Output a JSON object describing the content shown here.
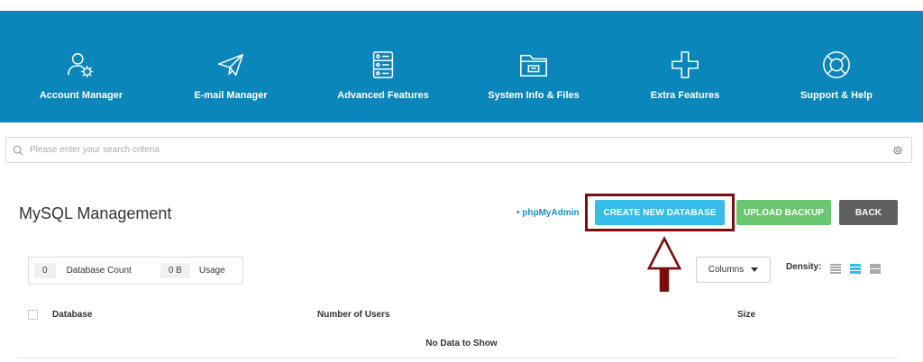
{
  "nav": {
    "items": [
      {
        "label": "Account Manager",
        "icon": "users-icon"
      },
      {
        "label": "E-mail Manager",
        "icon": "paper-plane-icon"
      },
      {
        "label": "Advanced Features",
        "icon": "server-icon"
      },
      {
        "label": "System Info & Files",
        "icon": "folder-icon"
      },
      {
        "label": "Extra Features",
        "icon": "plus-icon"
      },
      {
        "label": "Support & Help",
        "icon": "lifebuoy-icon"
      }
    ],
    "background": "#0a86bb"
  },
  "search": {
    "placeholder": "Please enter your search criteria"
  },
  "page": {
    "title": "MySQL Management",
    "phpmyadmin_link": "• phpMyAdmin"
  },
  "actions": {
    "create_label": "CREATE NEW DATABASE",
    "upload_label": "UPLOAD BACKUP",
    "back_label": "BACK",
    "colors": {
      "create": "#33bde8",
      "upload": "#6cc56f",
      "back": "#5f6062",
      "highlight": "#7a0d0d"
    }
  },
  "stats": {
    "db_count_value": "0",
    "db_count_label": "Database Count",
    "usage_value": "0 B",
    "usage_label": "Usage"
  },
  "controls": {
    "columns_label": "Columns",
    "density_label": "Density:"
  },
  "table": {
    "headers": [
      "Database",
      "Number of Users",
      "Size"
    ],
    "empty_text": "No Data to Show"
  }
}
